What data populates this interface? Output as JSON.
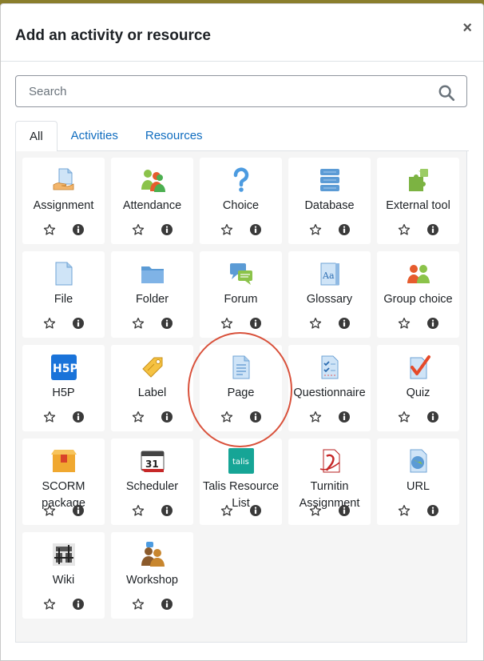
{
  "modal": {
    "title": "Add an activity or resource",
    "close_label": "×"
  },
  "search": {
    "placeholder": "Search"
  },
  "tabs": [
    {
      "label": "All",
      "active": true
    },
    {
      "label": "Activities",
      "active": false
    },
    {
      "label": "Resources",
      "active": false
    }
  ],
  "colors": {
    "link": "#0f6cbf",
    "highlight": "#d9523c",
    "info": "#3a3a3a"
  },
  "items": [
    {
      "label": "Assignment",
      "icon": "assignment-icon"
    },
    {
      "label": "Attendance",
      "icon": "attendance-icon"
    },
    {
      "label": "Choice",
      "icon": "choice-icon"
    },
    {
      "label": "Database",
      "icon": "database-icon"
    },
    {
      "label": "External tool",
      "icon": "puzzle-icon"
    },
    {
      "label": "File",
      "icon": "file-icon"
    },
    {
      "label": "Folder",
      "icon": "folder-icon"
    },
    {
      "label": "Forum",
      "icon": "forum-icon"
    },
    {
      "label": "Glossary",
      "icon": "glossary-icon"
    },
    {
      "label": "Group choice",
      "icon": "group-choice-icon"
    },
    {
      "label": "H5P",
      "icon": "h5p-icon"
    },
    {
      "label": "Label",
      "icon": "label-icon"
    },
    {
      "label": "Page",
      "icon": "page-icon"
    },
    {
      "label": "Questionnaire",
      "icon": "questionnaire-icon"
    },
    {
      "label": "Quiz",
      "icon": "quiz-icon"
    },
    {
      "label": "SCORM package",
      "icon": "scorm-icon"
    },
    {
      "label": "Scheduler",
      "icon": "calendar-icon"
    },
    {
      "label": "Talis Resource List",
      "icon": "talis-icon"
    },
    {
      "label": "Turnitin Assignment",
      "icon": "turnitin-icon"
    },
    {
      "label": "URL",
      "icon": "url-icon"
    },
    {
      "label": "Wiki",
      "icon": "wiki-icon"
    },
    {
      "label": "Workshop",
      "icon": "workshop-icon"
    }
  ],
  "h5p_text": "H5P",
  "talis_text": "talis",
  "calendar_day": "31"
}
